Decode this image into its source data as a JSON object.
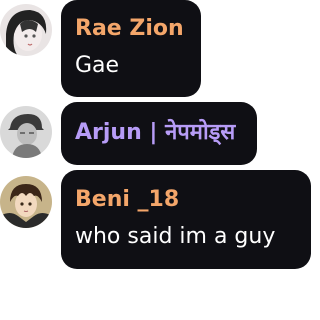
{
  "messages": [
    {
      "author": "Rae Zion",
      "author_color": "#f4a66a",
      "text": "Gae",
      "avatar_icon": "user-avatar-dark-hair"
    },
    {
      "author": "Arjun | नेपमोड्स",
      "author_color": "#b79cf7",
      "text": "",
      "avatar_icon": "user-avatar-grayscale"
    },
    {
      "author": "Beni _18",
      "author_color": "#f4a66a",
      "text": "who said im a guy",
      "avatar_icon": "user-avatar-anime"
    }
  ],
  "colors": {
    "bubble": "#0f0f14",
    "message_text": "#ffffff",
    "background": "#ffffff"
  }
}
